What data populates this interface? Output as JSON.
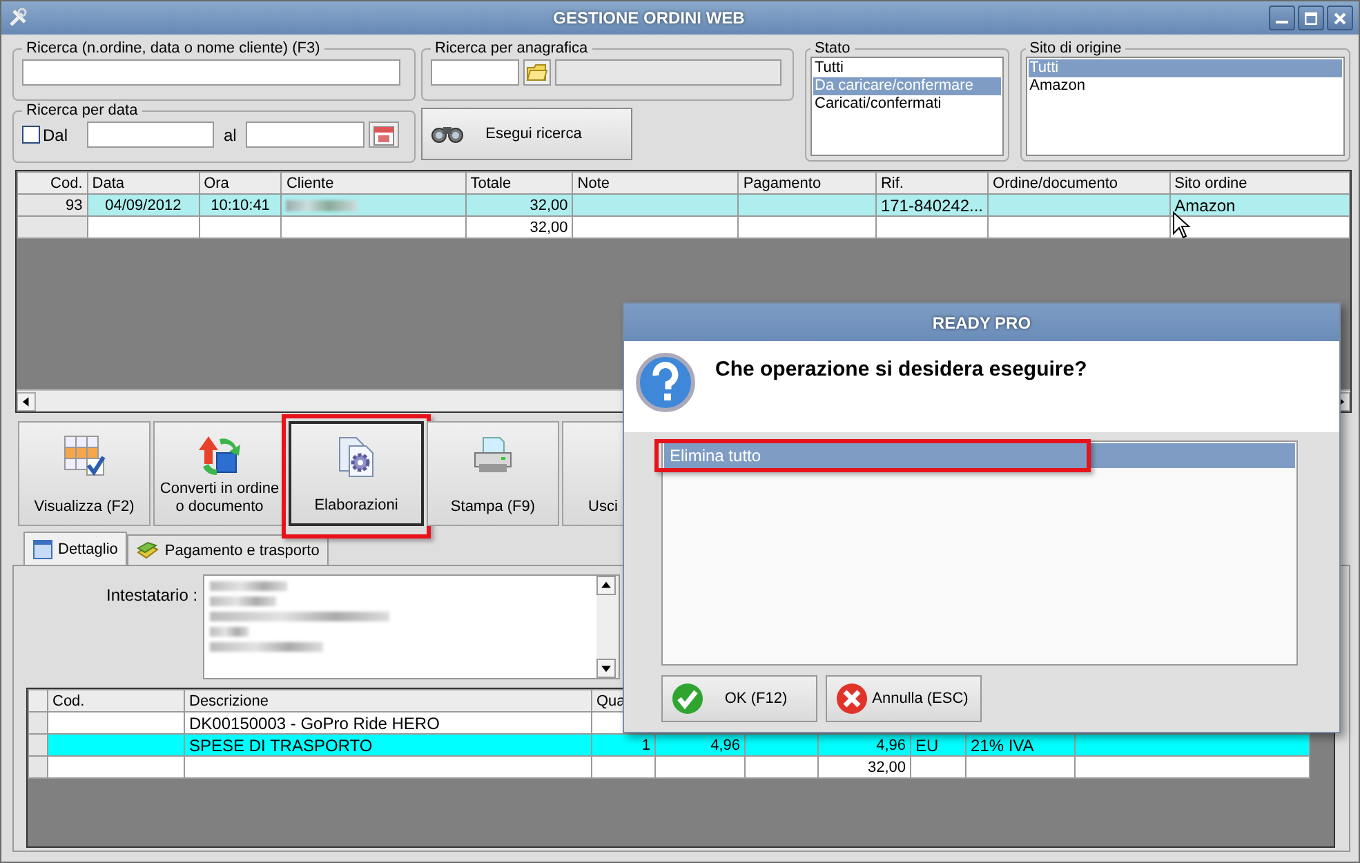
{
  "window": {
    "title": "GESTIONE ORDINI WEB"
  },
  "search": {
    "text_search": {
      "label": "Ricerca (n.ordine, data o nome cliente) (F3)"
    },
    "registry_search": {
      "label": "Ricerca per anagrafica"
    },
    "date_search": {
      "label": "Ricerca per data",
      "from": {
        "label": "Dal",
        "checked": false
      },
      "to_label": "al"
    },
    "search_button": {
      "label": "Esegui ricerca"
    }
  },
  "stato": {
    "label": "Stato",
    "items": [
      {
        "label": "Tutti",
        "selected": false
      },
      {
        "label": "Da caricare/confermare",
        "selected": true
      },
      {
        "label": "Caricati/confermati",
        "selected": false
      }
    ]
  },
  "sito_di_origine": {
    "label": "Sito di origine",
    "items": [
      {
        "label": "Tutti",
        "selected": true
      },
      {
        "label": "Amazon",
        "selected": false
      }
    ]
  },
  "orders": {
    "columns": [
      "Cod.",
      "Data",
      "Ora",
      "Cliente",
      "Totale",
      "Note",
      "Pagamento",
      "Rif.",
      "Ordine/documento",
      "Sito ordine"
    ],
    "rows": [
      {
        "cells": [
          "93",
          "04/09/2012",
          "10:10:41",
          null,
          "32,00",
          null,
          null,
          "171-840242...",
          null,
          "Amazon"
        ],
        "cliente_blurred": true,
        "selected": true
      },
      {
        "cells": [
          null,
          null,
          null,
          null,
          "32,00",
          null,
          null,
          null,
          null,
          null
        ],
        "cliente_blurred": false,
        "selected": false
      }
    ]
  },
  "toolbar": [
    {
      "label": "Visualizza (F2)",
      "kind": "grid",
      "pressed": false,
      "highlighted": false
    },
    {
      "label": "Converti in ordine o documento",
      "kind": "convert",
      "pressed": false,
      "highlighted": false
    },
    {
      "label": "Elaborazioni",
      "kind": "gear",
      "pressed": true,
      "highlighted": true
    },
    {
      "label": "Stampa (F9)",
      "kind": "printer",
      "pressed": false,
      "highlighted": false
    },
    {
      "label": "Usci",
      "kind": "exit",
      "pressed": false,
      "highlighted": false
    }
  ],
  "tabs": [
    {
      "label": "Dettaglio",
      "kind": "calendar",
      "selected": true
    },
    {
      "label": "Pagamento e trasporto",
      "kind": "money",
      "selected": false
    }
  ],
  "detail": {
    "holder_label": "Intestatario :",
    "holder_blurred": true,
    "columns": [
      "Cod.",
      "Descrizione",
      "Qua"
    ],
    "rows": [
      {
        "cells": [
          null,
          "DK00150003 - GoPro Ride HERO",
          null,
          null,
          null,
          null,
          null,
          null,
          null
        ],
        "selected": false
      },
      {
        "cells": [
          null,
          "SPESE DI TRASPORTO",
          "1",
          "4,96",
          null,
          "4,96",
          "EU",
          "21% IVA",
          null
        ],
        "selected": true
      },
      {
        "cells": [
          null,
          null,
          null,
          null,
          null,
          "32,00",
          null,
          null,
          null
        ],
        "selected": false
      }
    ]
  },
  "dialog": {
    "title": "READY PRO",
    "question": "Che operazione si desidera eseguire?",
    "items": [
      {
        "label": "Elimina tutto",
        "selected": true,
        "highlighted": true
      }
    ],
    "buttons": [
      {
        "label": "OK (F12)",
        "kind": "ok"
      },
      {
        "label": "Annulla (ESC)",
        "kind": "cancel"
      }
    ]
  }
}
